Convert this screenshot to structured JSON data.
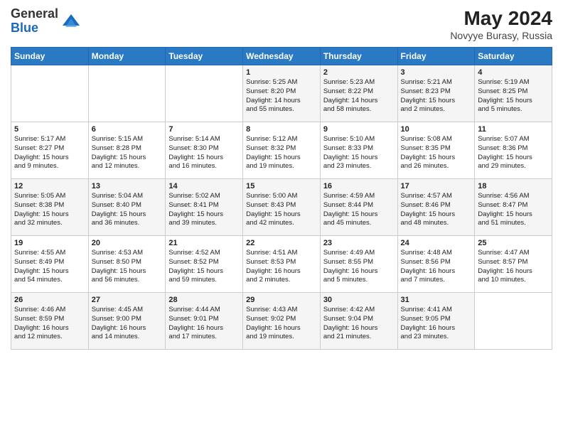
{
  "logo": {
    "general": "General",
    "blue": "Blue"
  },
  "title": "May 2024",
  "subtitle": "Novyye Burasy, Russia",
  "headers": [
    "Sunday",
    "Monday",
    "Tuesday",
    "Wednesday",
    "Thursday",
    "Friday",
    "Saturday"
  ],
  "weeks": [
    [
      {
        "day": "",
        "lines": []
      },
      {
        "day": "",
        "lines": []
      },
      {
        "day": "",
        "lines": []
      },
      {
        "day": "1",
        "lines": [
          "Sunrise: 5:25 AM",
          "Sunset: 8:20 PM",
          "Daylight: 14 hours",
          "and 55 minutes."
        ]
      },
      {
        "day": "2",
        "lines": [
          "Sunrise: 5:23 AM",
          "Sunset: 8:22 PM",
          "Daylight: 14 hours",
          "and 58 minutes."
        ]
      },
      {
        "day": "3",
        "lines": [
          "Sunrise: 5:21 AM",
          "Sunset: 8:23 PM",
          "Daylight: 15 hours",
          "and 2 minutes."
        ]
      },
      {
        "day": "4",
        "lines": [
          "Sunrise: 5:19 AM",
          "Sunset: 8:25 PM",
          "Daylight: 15 hours",
          "and 5 minutes."
        ]
      }
    ],
    [
      {
        "day": "5",
        "lines": [
          "Sunrise: 5:17 AM",
          "Sunset: 8:27 PM",
          "Daylight: 15 hours",
          "and 9 minutes."
        ]
      },
      {
        "day": "6",
        "lines": [
          "Sunrise: 5:15 AM",
          "Sunset: 8:28 PM",
          "Daylight: 15 hours",
          "and 12 minutes."
        ]
      },
      {
        "day": "7",
        "lines": [
          "Sunrise: 5:14 AM",
          "Sunset: 8:30 PM",
          "Daylight: 15 hours",
          "and 16 minutes."
        ]
      },
      {
        "day": "8",
        "lines": [
          "Sunrise: 5:12 AM",
          "Sunset: 8:32 PM",
          "Daylight: 15 hours",
          "and 19 minutes."
        ]
      },
      {
        "day": "9",
        "lines": [
          "Sunrise: 5:10 AM",
          "Sunset: 8:33 PM",
          "Daylight: 15 hours",
          "and 23 minutes."
        ]
      },
      {
        "day": "10",
        "lines": [
          "Sunrise: 5:08 AM",
          "Sunset: 8:35 PM",
          "Daylight: 15 hours",
          "and 26 minutes."
        ]
      },
      {
        "day": "11",
        "lines": [
          "Sunrise: 5:07 AM",
          "Sunset: 8:36 PM",
          "Daylight: 15 hours",
          "and 29 minutes."
        ]
      }
    ],
    [
      {
        "day": "12",
        "lines": [
          "Sunrise: 5:05 AM",
          "Sunset: 8:38 PM",
          "Daylight: 15 hours",
          "and 32 minutes."
        ]
      },
      {
        "day": "13",
        "lines": [
          "Sunrise: 5:04 AM",
          "Sunset: 8:40 PM",
          "Daylight: 15 hours",
          "and 36 minutes."
        ]
      },
      {
        "day": "14",
        "lines": [
          "Sunrise: 5:02 AM",
          "Sunset: 8:41 PM",
          "Daylight: 15 hours",
          "and 39 minutes."
        ]
      },
      {
        "day": "15",
        "lines": [
          "Sunrise: 5:00 AM",
          "Sunset: 8:43 PM",
          "Daylight: 15 hours",
          "and 42 minutes."
        ]
      },
      {
        "day": "16",
        "lines": [
          "Sunrise: 4:59 AM",
          "Sunset: 8:44 PM",
          "Daylight: 15 hours",
          "and 45 minutes."
        ]
      },
      {
        "day": "17",
        "lines": [
          "Sunrise: 4:57 AM",
          "Sunset: 8:46 PM",
          "Daylight: 15 hours",
          "and 48 minutes."
        ]
      },
      {
        "day": "18",
        "lines": [
          "Sunrise: 4:56 AM",
          "Sunset: 8:47 PM",
          "Daylight: 15 hours",
          "and 51 minutes."
        ]
      }
    ],
    [
      {
        "day": "19",
        "lines": [
          "Sunrise: 4:55 AM",
          "Sunset: 8:49 PM",
          "Daylight: 15 hours",
          "and 54 minutes."
        ]
      },
      {
        "day": "20",
        "lines": [
          "Sunrise: 4:53 AM",
          "Sunset: 8:50 PM",
          "Daylight: 15 hours",
          "and 56 minutes."
        ]
      },
      {
        "day": "21",
        "lines": [
          "Sunrise: 4:52 AM",
          "Sunset: 8:52 PM",
          "Daylight: 15 hours",
          "and 59 minutes."
        ]
      },
      {
        "day": "22",
        "lines": [
          "Sunrise: 4:51 AM",
          "Sunset: 8:53 PM",
          "Daylight: 16 hours",
          "and 2 minutes."
        ]
      },
      {
        "day": "23",
        "lines": [
          "Sunrise: 4:49 AM",
          "Sunset: 8:55 PM",
          "Daylight: 16 hours",
          "and 5 minutes."
        ]
      },
      {
        "day": "24",
        "lines": [
          "Sunrise: 4:48 AM",
          "Sunset: 8:56 PM",
          "Daylight: 16 hours",
          "and 7 minutes."
        ]
      },
      {
        "day": "25",
        "lines": [
          "Sunrise: 4:47 AM",
          "Sunset: 8:57 PM",
          "Daylight: 16 hours",
          "and 10 minutes."
        ]
      }
    ],
    [
      {
        "day": "26",
        "lines": [
          "Sunrise: 4:46 AM",
          "Sunset: 8:59 PM",
          "Daylight: 16 hours",
          "and 12 minutes."
        ]
      },
      {
        "day": "27",
        "lines": [
          "Sunrise: 4:45 AM",
          "Sunset: 9:00 PM",
          "Daylight: 16 hours",
          "and 14 minutes."
        ]
      },
      {
        "day": "28",
        "lines": [
          "Sunrise: 4:44 AM",
          "Sunset: 9:01 PM",
          "Daylight: 16 hours",
          "and 17 minutes."
        ]
      },
      {
        "day": "29",
        "lines": [
          "Sunrise: 4:43 AM",
          "Sunset: 9:02 PM",
          "Daylight: 16 hours",
          "and 19 minutes."
        ]
      },
      {
        "day": "30",
        "lines": [
          "Sunrise: 4:42 AM",
          "Sunset: 9:04 PM",
          "Daylight: 16 hours",
          "and 21 minutes."
        ]
      },
      {
        "day": "31",
        "lines": [
          "Sunrise: 4:41 AM",
          "Sunset: 9:05 PM",
          "Daylight: 16 hours",
          "and 23 minutes."
        ]
      },
      {
        "day": "",
        "lines": []
      }
    ]
  ]
}
